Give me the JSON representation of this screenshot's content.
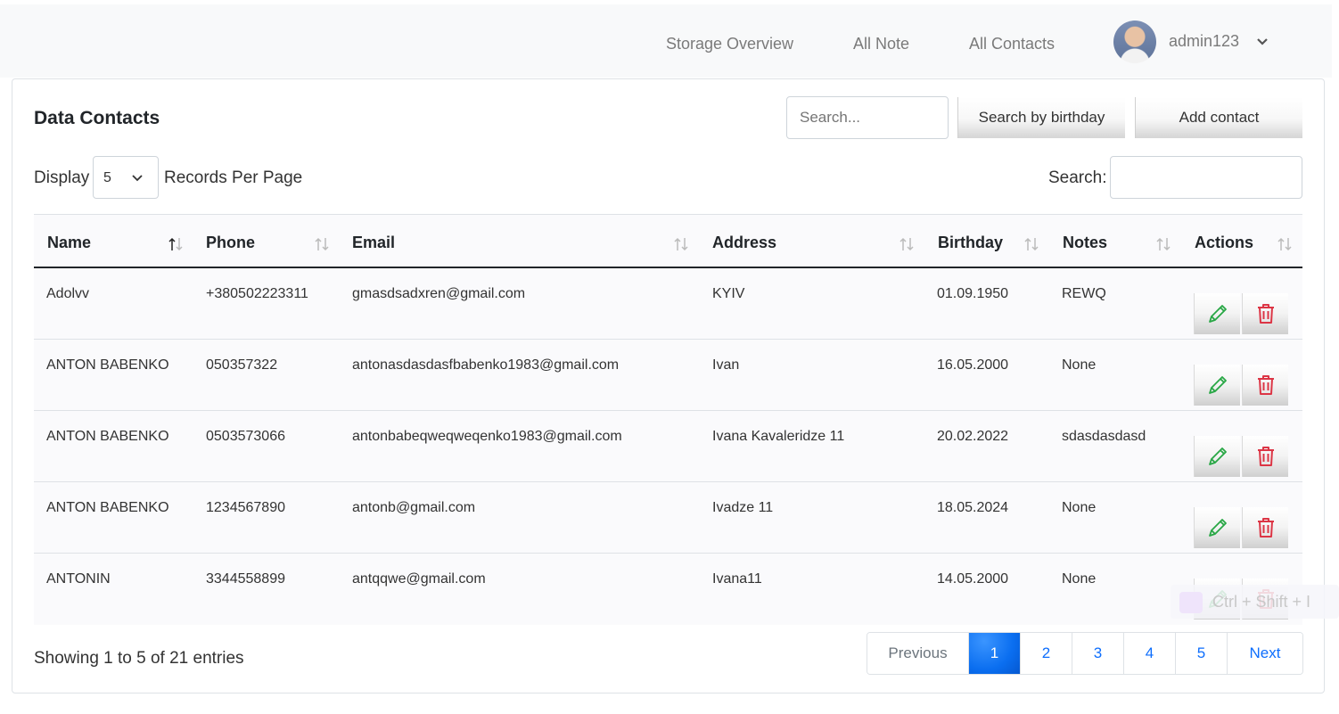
{
  "nav": {
    "links": [
      "Storage Overview",
      "All Note",
      "All Contacts"
    ],
    "user": "admin123"
  },
  "card": {
    "title": "Data Contacts",
    "search_placeholder": "Search...",
    "search_birthday_label": "Search by birthday",
    "add_contact_label": "Add contact"
  },
  "controls": {
    "display_label": "Display",
    "page_size": "5",
    "records_label": "Records Per Page",
    "search_label": "Search:"
  },
  "table": {
    "columns": [
      "Name",
      "Phone",
      "Email",
      "Address",
      "Birthday",
      "Notes",
      "Actions"
    ],
    "rows": [
      {
        "name": "Adolvv",
        "phone": "+380502223311",
        "email": "gmasdsadxren@gmail.com",
        "address": "KYIV",
        "birthday": "01.09.1950",
        "notes": "REWQ"
      },
      {
        "name": "ANTON BABENKO",
        "phone": "050357322",
        "email": "antonasdasdasfbabenko1983@gmail.com",
        "address": "Ivan",
        "birthday": "16.05.2000",
        "notes": "None"
      },
      {
        "name": "ANTON BABENKO",
        "phone": "0503573066",
        "email": "antonbabeqweqweqenko1983@gmail.com",
        "address": "Ivana Kavaleridze 11",
        "birthday": "20.02.2022",
        "notes": "sdasdasdasd"
      },
      {
        "name": "ANTON BABENKO",
        "phone": "1234567890",
        "email": "antonb@gmail.com",
        "address": "Ivadze 11",
        "birthday": "18.05.2024",
        "notes": "None"
      },
      {
        "name": "ANTONIN",
        "phone": "3344558899",
        "email": "antqqwe@gmail.com",
        "address": "Ivana11",
        "birthday": "14.05.2000",
        "notes": "None"
      }
    ]
  },
  "footer": {
    "showing": "Showing 1 to 5 of 21 entries",
    "pages": [
      "Previous",
      "1",
      "2",
      "3",
      "4",
      "5",
      "Next"
    ],
    "active_page": "1"
  },
  "overlay": {
    "shortcut": "Ctrl + Shift + I"
  },
  "colors": {
    "edit": "#28a745",
    "delete": "#dc3545",
    "accent": "#0d6efd"
  },
  "icons": {
    "edit": "pencil-icon",
    "delete": "trash-icon",
    "sort": "sort-arrows-icon",
    "dropdown": "chevron-down-icon"
  }
}
